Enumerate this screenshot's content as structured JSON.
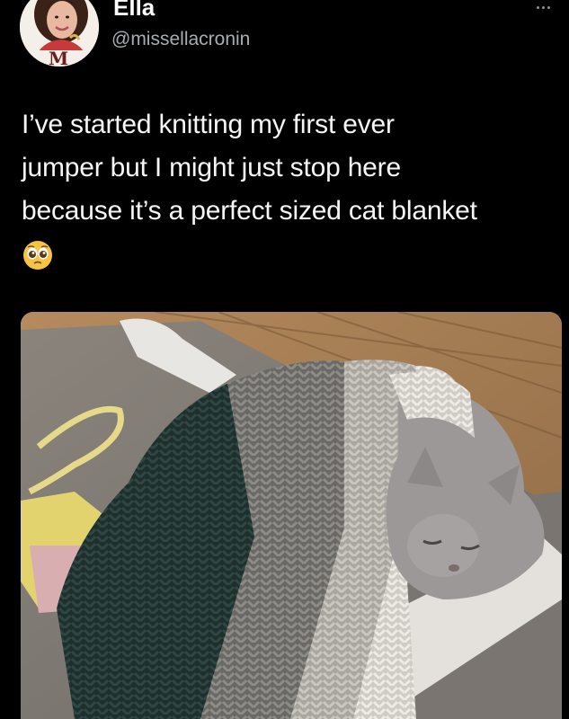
{
  "tweet": {
    "author": {
      "display_name": "Ella",
      "handle": "@missellacronin",
      "avatar_letter": "M"
    },
    "text_lines": [
      "I’ve started knitting my first ever",
      "jumper but I might just stop here",
      "because it’s a perfect sized cat blanket"
    ],
    "emoji": "pleading-face-emoji",
    "more_icon": "more-options-icon",
    "media": {
      "description_icon": "photo-cat-under-knitted-blanket"
    }
  },
  "colors": {
    "background": "#000000",
    "text": "#f5f5f5",
    "handle": "#a7adb2"
  }
}
